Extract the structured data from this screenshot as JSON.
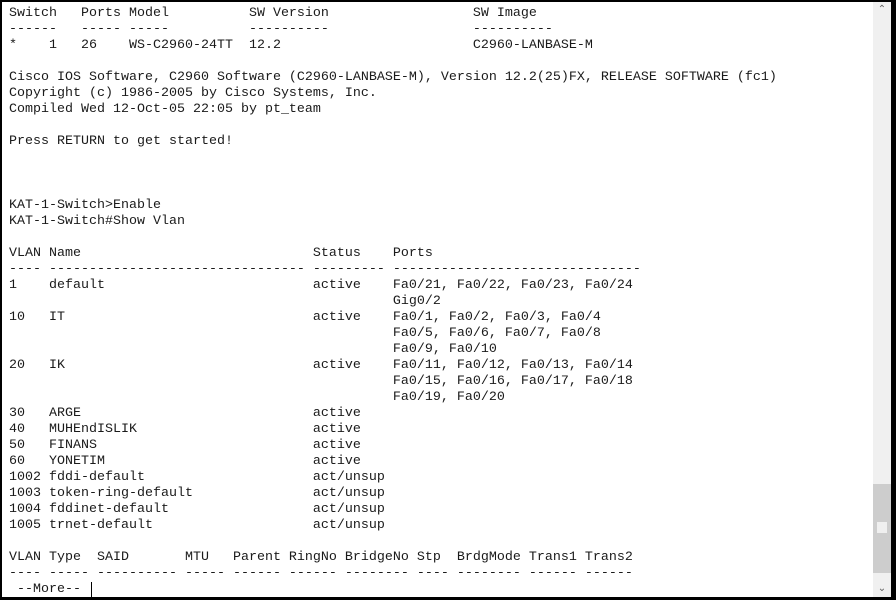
{
  "switch_table": {
    "header": [
      "Switch",
      "Ports",
      "Model",
      "SW Version",
      "SW Image"
    ],
    "rows": [
      [
        "*",
        "1",
        "26",
        "WS-C2960-24TT",
        "12.2",
        "C2960-LANBASE-M"
      ]
    ]
  },
  "banner": [
    "Cisco IOS Software, C2960 Software (C2960-LANBASE-M), Version 12.2(25)FX, RELEASE SOFTWARE (fc1)",
    "Copyright (c) 1986-2005 by Cisco Systems, Inc.",
    "Compiled Wed 12-Oct-05 22:05 by pt_team",
    "",
    "Press RETURN to get started!",
    "",
    "",
    "",
    "KAT-1-Switch>Enable",
    "KAT-1-Switch#Show Vlan"
  ],
  "vlan_table": {
    "header": [
      "VLAN",
      "Name",
      "Status",
      "Ports"
    ],
    "rows": [
      {
        "id": "1",
        "name": "default",
        "status": "active",
        "ports": [
          "Fa0/21, Fa0/22, Fa0/23, Fa0/24",
          "Gig0/2"
        ]
      },
      {
        "id": "10",
        "name": "IT",
        "status": "active",
        "ports": [
          "Fa0/1, Fa0/2, Fa0/3, Fa0/4",
          "Fa0/5, Fa0/6, Fa0/7, Fa0/8",
          "Fa0/9, Fa0/10"
        ]
      },
      {
        "id": "20",
        "name": "IK",
        "status": "active",
        "ports": [
          "Fa0/11, Fa0/12, Fa0/13, Fa0/14",
          "Fa0/15, Fa0/16, Fa0/17, Fa0/18",
          "Fa0/19, Fa0/20"
        ]
      },
      {
        "id": "30",
        "name": "ARGE",
        "status": "active",
        "ports": []
      },
      {
        "id": "40",
        "name": "MUHEndISLIK",
        "status": "active",
        "ports": []
      },
      {
        "id": "50",
        "name": "FINANS",
        "status": "active",
        "ports": []
      },
      {
        "id": "60",
        "name": "YONETIM",
        "status": "active",
        "ports": []
      },
      {
        "id": "1002",
        "name": "fddi-default",
        "status": "act/unsup",
        "ports": []
      },
      {
        "id": "1003",
        "name": "token-ring-default",
        "status": "act/unsup",
        "ports": []
      },
      {
        "id": "1004",
        "name": "fddinet-default",
        "status": "act/unsup",
        "ports": []
      },
      {
        "id": "1005",
        "name": "trnet-default",
        "status": "act/unsup",
        "ports": []
      }
    ]
  },
  "type_table": {
    "header": [
      "VLAN",
      "Type",
      "SAID",
      "MTU",
      "Parent",
      "RingNo",
      "BridgeNo",
      "Stp",
      "BrdgMode",
      "Trans1",
      "Trans2"
    ]
  },
  "prompt": "--More--",
  "icons": {
    "scroll_up": "chevron-up-icon",
    "scroll_down": "chevron-down-icon"
  }
}
